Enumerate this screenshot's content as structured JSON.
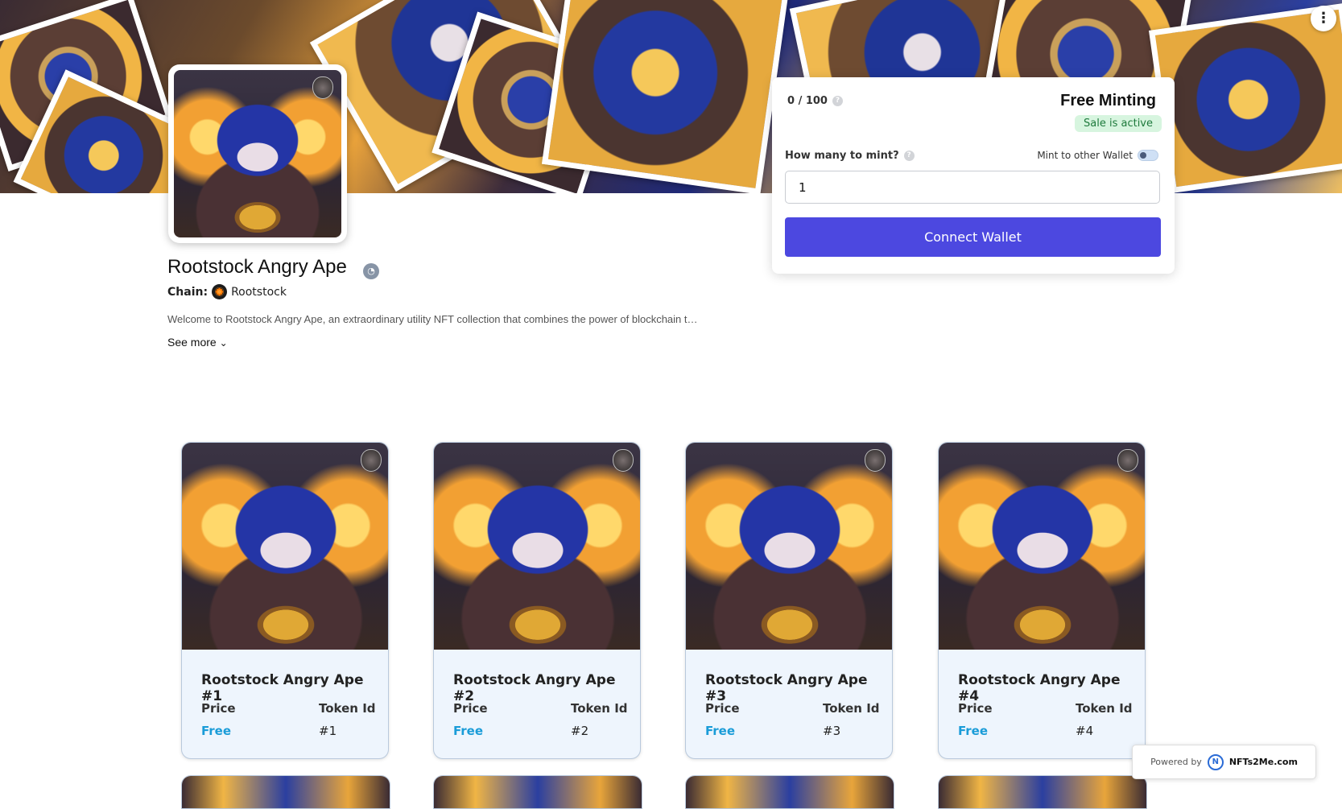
{
  "menu": {
    "icon": "more-vertical-icon",
    "label": "⋮"
  },
  "collection": {
    "name": "Rootstock Angry Ape",
    "chain_label": "Chain:",
    "chain_name": "Rootstock",
    "description": "Welcome to Rootstock Angry Ape, an extraordinary utility NFT collection that combines the power of blockchain t…",
    "see_more": "See more",
    "see_more_icon": "chevron-down-icon"
  },
  "mint_panel": {
    "supply": "0 / 100",
    "help_mark": "?",
    "title": "Free Minting",
    "status": "Sale is active",
    "quantity_label": "How many to mint?",
    "other_wallet_label": "Mint to other Wallet",
    "quantity_value": "1",
    "connect_label": "Connect Wallet"
  },
  "cards": [
    {
      "name": "Rootstock Angry Ape #1",
      "price_label": "Price",
      "token_label": "Token Id",
      "price": "Free",
      "token": "#1"
    },
    {
      "name": "Rootstock Angry Ape #2",
      "price_label": "Price",
      "token_label": "Token Id",
      "price": "Free",
      "token": "#2"
    },
    {
      "name": "Rootstock Angry Ape #3",
      "price_label": "Price",
      "token_label": "Token Id",
      "price": "Free",
      "token": "#3"
    },
    {
      "name": "Rootstock Angry Ape #4",
      "price_label": "Price",
      "token_label": "Token Id",
      "price": "Free",
      "token": "#4"
    }
  ],
  "footer": {
    "powered_by": "Powered by",
    "brand": "NFTs2Me.com",
    "brand_mark": "N"
  },
  "colors": {
    "accent": "#4c48e0",
    "price": "#1a9cd8",
    "sale_badge_bg": "#d7f5df",
    "sale_badge_text": "#1e7a3c"
  }
}
